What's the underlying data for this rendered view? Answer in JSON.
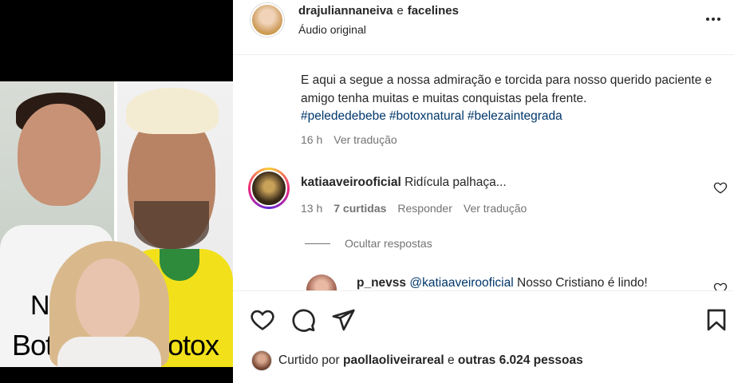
{
  "media": {
    "overlay_text": {
      "no": "NO",
      "boto": "Bot",
      "otox": "otox"
    }
  },
  "header": {
    "author": "drajuliannaneiva",
    "connector": "e",
    "coauthor": "facelines",
    "audio": "Áudio original",
    "more_icon": "more-horizontal-icon"
  },
  "caption": {
    "text": "E aqui a segue a nossa admiração e torcida para nosso querido paciente e amigo tenha muitas e muitas conquistas pela frente.",
    "hashtags": [
      "#pelededebebe",
      "#botoxnatural",
      "#belezaintegrada"
    ],
    "time": "16 h",
    "see_translation": "Ver tradução"
  },
  "comment": {
    "user": "katiaaveirooficial",
    "text": "Ridícula palhaça...",
    "time": "13 h",
    "likes": "7 curtidas",
    "reply": "Responder",
    "see_translation": "Ver tradução",
    "hide_replies": "Ocultar respostas"
  },
  "reply": {
    "user": "p_nevss",
    "mention": "@katiaaveirooficial",
    "text": "Nosso Cristiano é lindo!"
  },
  "actions": {
    "liked_prefix": "Curtido por",
    "liked_user": "paollaoliveirareal",
    "liked_connector": "e",
    "liked_others": "outras 6.024 pessoas"
  },
  "colors": {
    "text": "#262626",
    "muted": "#737373",
    "link": "#00376b"
  }
}
